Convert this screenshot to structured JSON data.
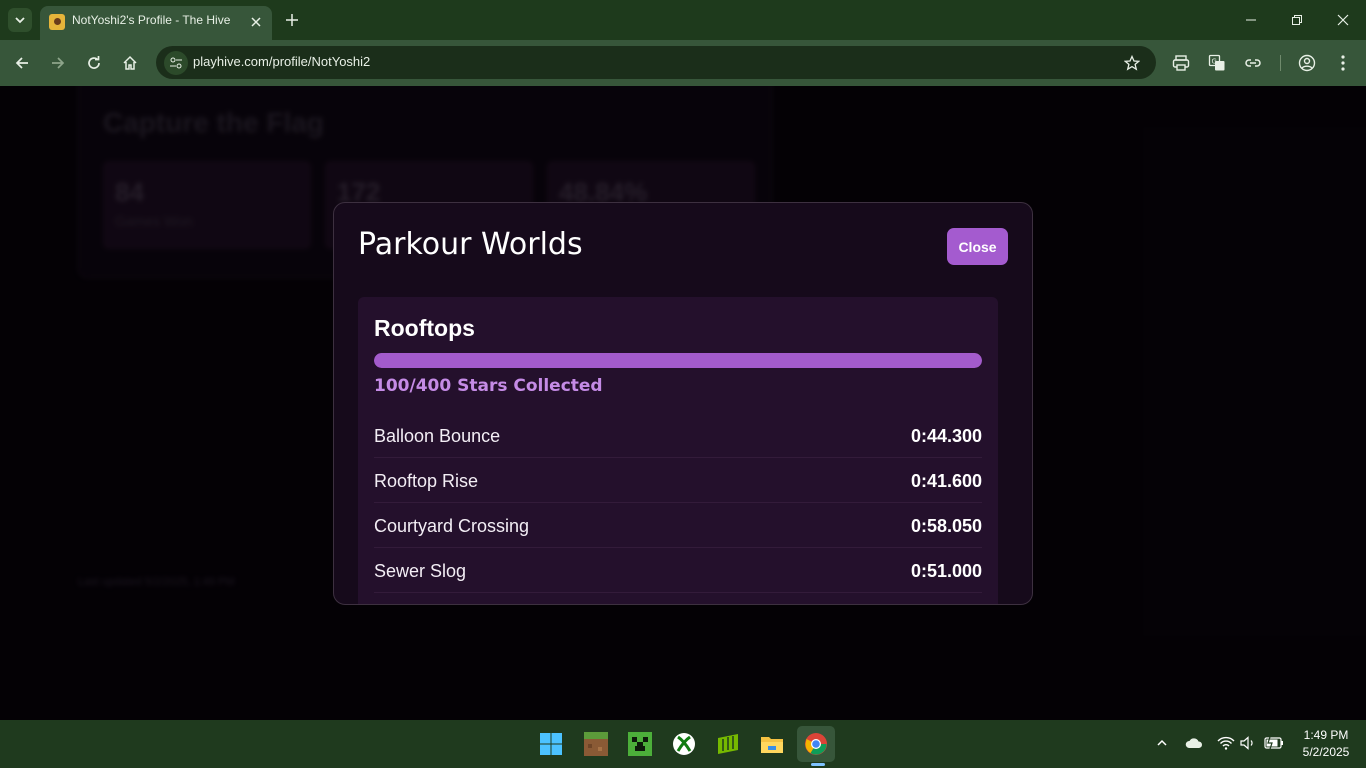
{
  "browser": {
    "tab_title": "NotYoshi2's Profile - The Hive",
    "url": "playhive.com/profile/NotYoshi2"
  },
  "background": {
    "section_title": "Capture the Flag",
    "stats": [
      {
        "value": "84",
        "label": "Games Won"
      },
      {
        "value": "172",
        "label": ""
      },
      {
        "value": "48.84%",
        "label": ""
      }
    ],
    "last_updated": "Last updated 5/2/2025, 1:49 PM"
  },
  "modal": {
    "title": "Parkour Worlds",
    "close_label": "Close",
    "world": {
      "name": "Rooftops",
      "stars_text": "100/400 Stars Collected",
      "progress_fraction": 1.0,
      "levels": [
        {
          "name": "Balloon Bounce",
          "time": "0:44.300"
        },
        {
          "name": "Rooftop Rise",
          "time": "0:41.600"
        },
        {
          "name": "Courtyard Crossing",
          "time": "0:58.050"
        },
        {
          "name": "Sewer Slog",
          "time": "0:51.000"
        }
      ]
    }
  },
  "taskbar": {
    "time": "1:49 PM",
    "date": "5/2/2025",
    "apps": [
      "windows-start",
      "minecraft-grass-block",
      "minecraft-creeper",
      "xbox",
      "nvidia-app",
      "file-explorer",
      "chrome"
    ]
  },
  "colors": {
    "accent": "#a45bcf",
    "modal_bg": "#160a1b",
    "card_bg": "#24102c",
    "chrome_bg": "#37563a"
  }
}
